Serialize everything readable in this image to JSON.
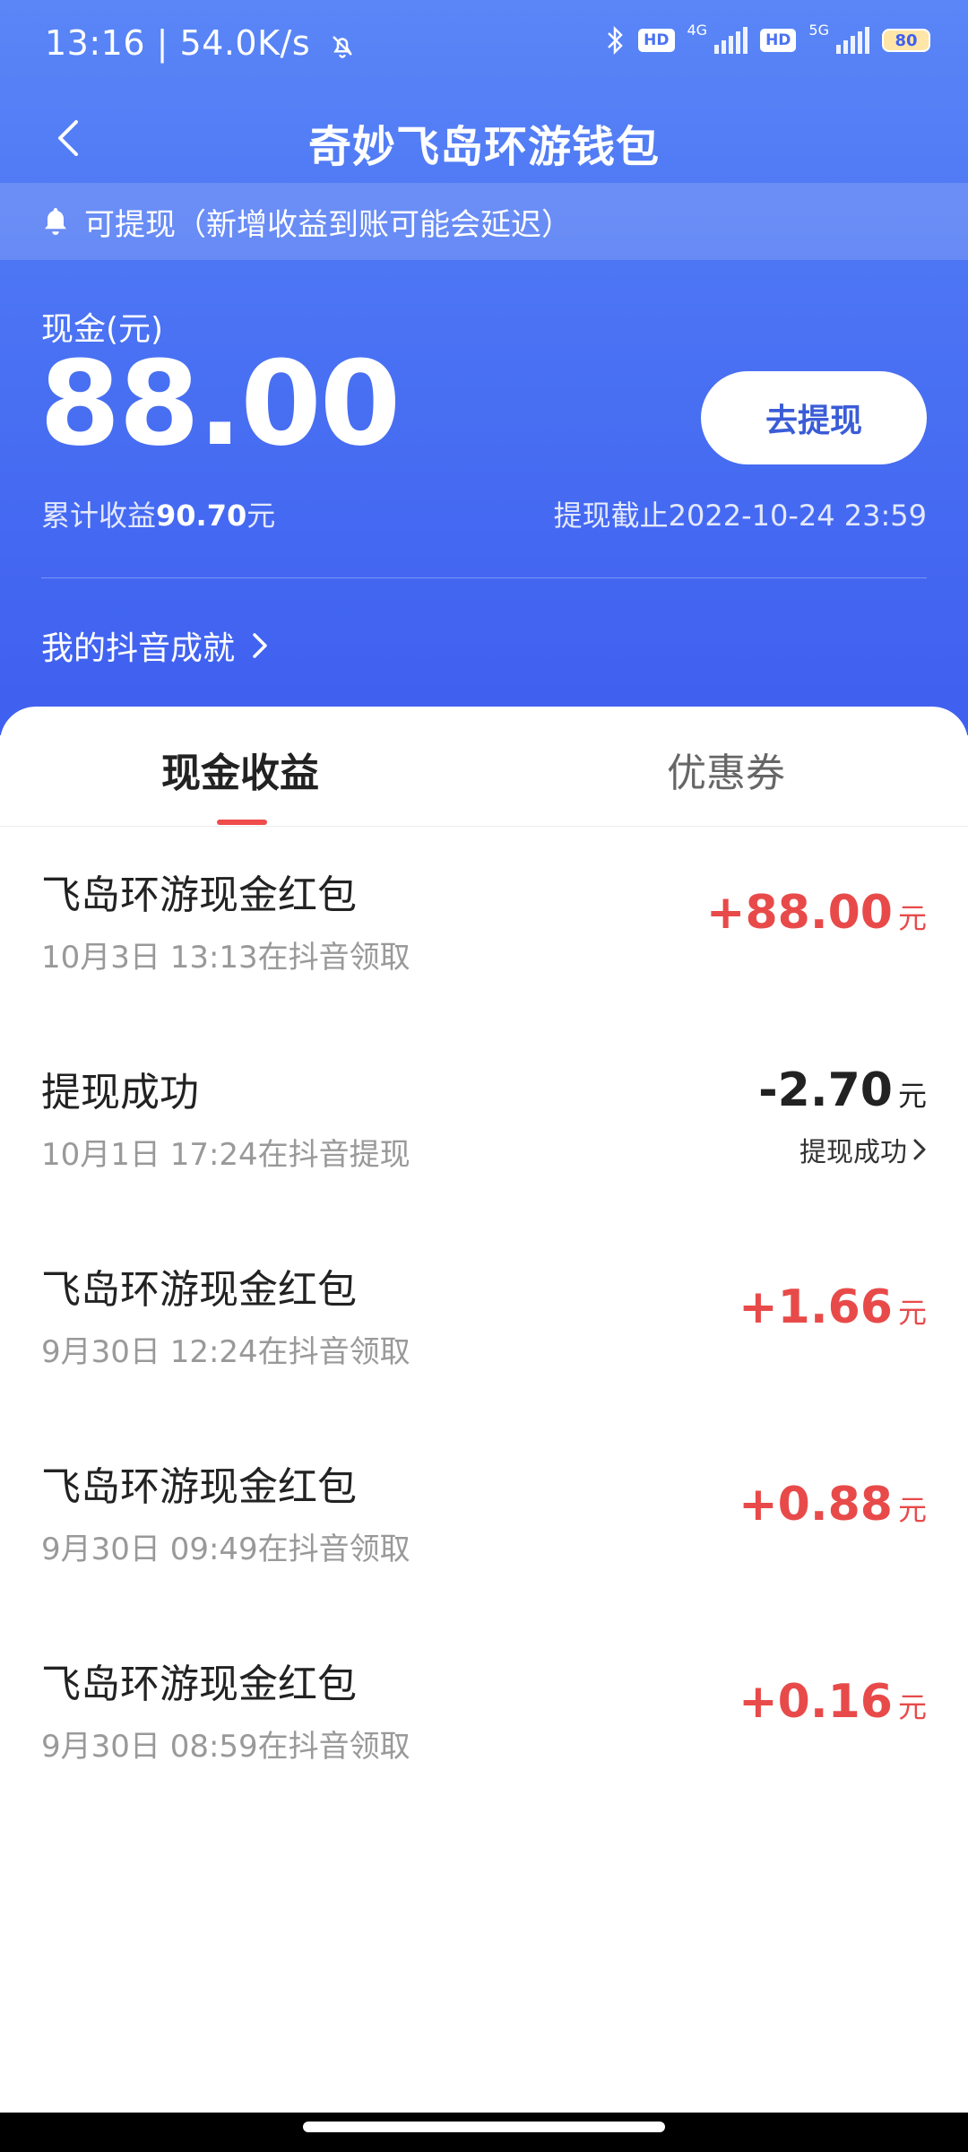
{
  "status_bar": {
    "time": "13:16",
    "speed": "54.0K/s",
    "network1": "4G",
    "network2": "5G",
    "hd": "HD",
    "battery": "80"
  },
  "header": {
    "title": "奇妙飞岛环游钱包"
  },
  "notice": {
    "text": "可提现（新增收益到账可能会延迟）"
  },
  "wallet": {
    "cash_label": "现金(元)",
    "cash_value": "88.00",
    "withdraw_button": "去提现",
    "total_prefix": "累计收益",
    "total_value": "90.70",
    "total_suffix": "元",
    "deadline": "提现截止2022-10-24 23:59",
    "achievements": "我的抖音成就"
  },
  "tabs": [
    {
      "label": "现金收益",
      "active": true
    },
    {
      "label": "优惠券",
      "active": false
    }
  ],
  "transactions": [
    {
      "title": "飞岛环游现金红包",
      "subtitle": "10月3日 13:13在抖音领取",
      "amount": "+88.00",
      "unit": "元",
      "type": "positive"
    },
    {
      "title": "提现成功",
      "subtitle": "10月1日 17:24在抖音提现",
      "amount": "-2.70",
      "unit": "元",
      "type": "negative",
      "status": "提现成功"
    },
    {
      "title": "飞岛环游现金红包",
      "subtitle": "9月30日 12:24在抖音领取",
      "amount": "+1.66",
      "unit": "元",
      "type": "positive"
    },
    {
      "title": "飞岛环游现金红包",
      "subtitle": "9月30日 09:49在抖音领取",
      "amount": "+0.88",
      "unit": "元",
      "type": "positive"
    },
    {
      "title": "飞岛环游现金红包",
      "subtitle": "9月30日 08:59在抖音领取",
      "amount": "+0.16",
      "unit": "元",
      "type": "positive"
    }
  ],
  "colors": {
    "header_blue": "#4a72f3",
    "positive_red": "#e84a4a",
    "tab_indicator": "#f04c4c"
  }
}
